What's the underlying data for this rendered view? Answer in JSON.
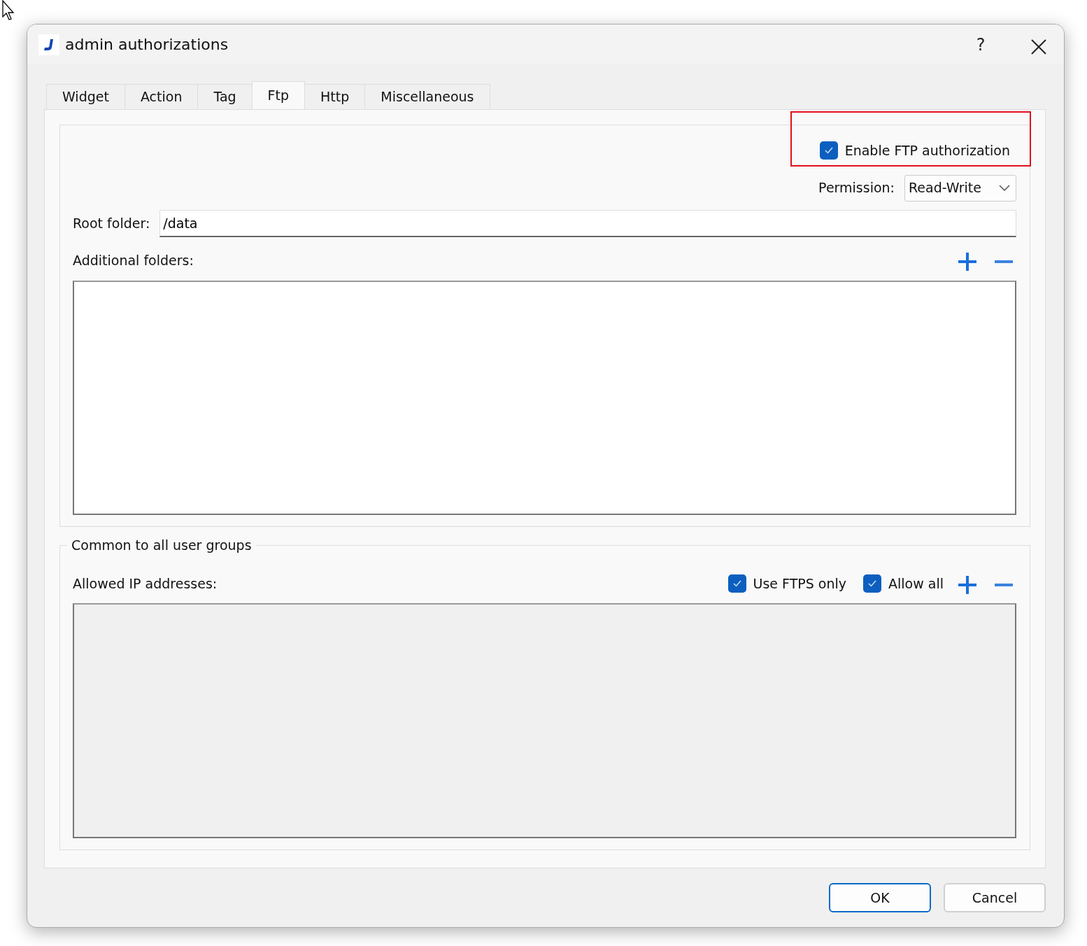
{
  "window": {
    "title": "admin authorizations",
    "help_button": "?"
  },
  "tabs": [
    {
      "label": "Widget",
      "selected": false
    },
    {
      "label": "Action",
      "selected": false
    },
    {
      "label": "Tag",
      "selected": false
    },
    {
      "label": "Ftp",
      "selected": true
    },
    {
      "label": "Http",
      "selected": false
    },
    {
      "label": "Miscellaneous",
      "selected": false
    }
  ],
  "ftp": {
    "enable": {
      "label": "Enable FTP authorization",
      "checked": true,
      "highlighted": true
    },
    "permission": {
      "label": "Permission:",
      "value": "Read-Write"
    },
    "root_folder": {
      "label": "Root folder:",
      "value": "/data"
    },
    "additional_folders": {
      "label": "Additional folders:",
      "disabled": false
    }
  },
  "common": {
    "title": "Common to all user groups",
    "allowed_ip_label": "Allowed IP addresses:",
    "options": [
      {
        "label": "Use FTPS only",
        "checked": true
      },
      {
        "label": "Allow all",
        "checked": true
      }
    ],
    "ip_list": {
      "disabled": true
    }
  },
  "buttons": [
    {
      "label": "OK",
      "default": true
    },
    {
      "label": "Cancel",
      "default": false
    }
  ]
}
